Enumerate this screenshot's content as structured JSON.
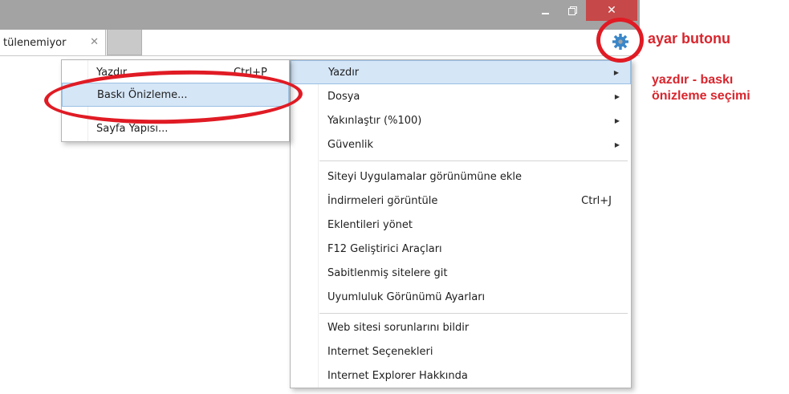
{
  "window": {
    "close_glyph": "✕"
  },
  "tab": {
    "title": "tülenemiyor",
    "close_glyph": "✕"
  },
  "toolbar": {
    "icons": [
      "home-icon",
      "star-icon",
      "gear-icon"
    ],
    "gear_color": "#3a86c8"
  },
  "annotations": {
    "settings_button": "ayar butonu",
    "print_preview_line1": "yazdır - baskı",
    "print_preview_line2": "önizleme seçimi",
    "color": "#e01b24"
  },
  "main_menu": {
    "items": [
      {
        "label": "Yazdır",
        "has_submenu": true,
        "highlighted": true
      },
      {
        "label": "Dosya",
        "has_submenu": true
      },
      {
        "label": "Yakınlaştır (%100)",
        "has_submenu": true
      },
      {
        "label": "Güvenlik",
        "has_submenu": true
      },
      {
        "label": "Siteyi Uygulamalar görünümüne ekle"
      },
      {
        "label": "İndirmeleri görüntüle",
        "shortcut": "Ctrl+J"
      },
      {
        "label": "Eklentileri yönet"
      },
      {
        "label": "F12 Geliştirici Araçları"
      },
      {
        "label": "Sabitlenmiş sitelere git"
      },
      {
        "label": "Uyumluluk Görünümü Ayarları"
      },
      {
        "label": "Web sitesi sorunlarını bildir"
      },
      {
        "label": "Internet Seçenekleri"
      },
      {
        "label": "Internet Explorer Hakkında"
      }
    ],
    "arrow_glyph": "▶",
    "highlight_color": "#d5e6f7"
  },
  "print_submenu": {
    "items": [
      {
        "label": "Yazdır...",
        "shortcut": "Ctrl+P"
      },
      {
        "label": "Baskı Önizleme...",
        "highlighted": true
      },
      {
        "label": "Sayfa Yapısı..."
      }
    ]
  }
}
